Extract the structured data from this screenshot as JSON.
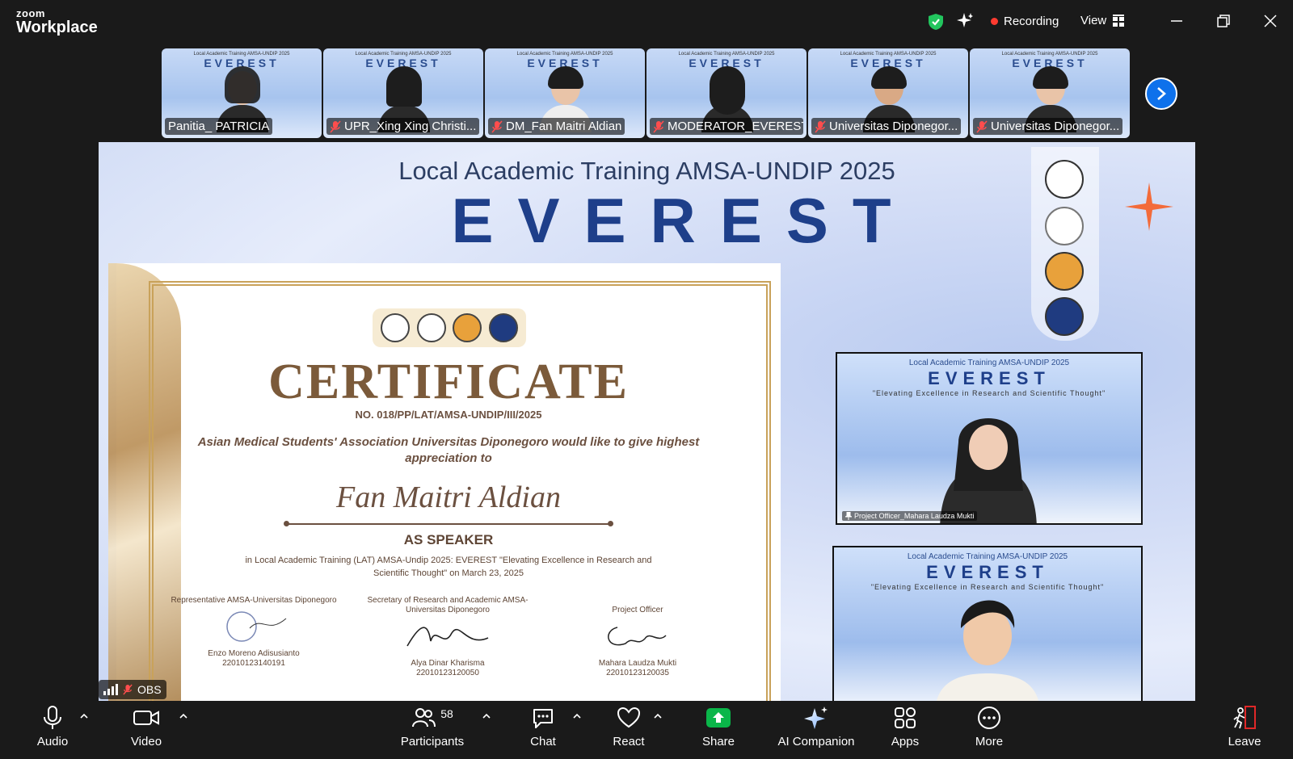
{
  "app": {
    "brand_small": "zoom",
    "brand_name": "Workplace"
  },
  "titlebar": {
    "recording_label": "Recording",
    "view_label": "View"
  },
  "participants_strip": [
    {
      "name": "Panitia_ PATRICIA",
      "muted": false
    },
    {
      "name": "UPR_Xing Xing Christi...",
      "muted": true
    },
    {
      "name": "DM_Fan Maitri Aldian",
      "muted": true
    },
    {
      "name": "MODERATOR_EVEREST",
      "muted": true
    },
    {
      "name": "Universitas Diponegor...",
      "muted": true
    },
    {
      "name": "Universitas Diponegor...",
      "muted": true
    }
  ],
  "thumb_banner": {
    "top": "Local Academic Training AMSA-UNDIP 2025",
    "big": "EVEREST",
    "sub": "\"Elevating Excellence in Research and Scientific Thought\""
  },
  "slide": {
    "title": "Local Academic Training AMSA-UNDIP 2025",
    "big": "EVEREST"
  },
  "certificate": {
    "title": "CERTIFICATE",
    "number": "NO. 018/PP/LAT/AMSA-UNDIP/III/2025",
    "give_text": "Asian Medical Students' Association Universitas Diponegoro would like to give highest appreciation to",
    "recipient": "Fan Maitri Aldian",
    "role": "AS SPEAKER",
    "description": "in Local Academic Training (LAT) AMSA-Undip 2025: EVEREST \"Elevating Excellence in Research and Scientific Thought\" on March 23, 2025",
    "signatories": [
      {
        "title": "Representative AMSA-Universitas Diponegoro",
        "name": "Enzo Moreno Adisusianto",
        "id": "22010123140191"
      },
      {
        "title": "Secretary of Research and Academic AMSA-Universitas Diponegoro",
        "name": "Alya Dinar Kharisma",
        "id": "22010123120050"
      },
      {
        "title": "Project Officer",
        "name": "Mahara Laudza Mukti",
        "id": "22010123120035"
      }
    ]
  },
  "presenter_videos": [
    {
      "top": "Local Academic Training AMSA-UNDIP 2025",
      "big": "EVEREST",
      "sub": "\"Elevating Excellence in Research and Scientific Thought\"",
      "label": "Project Officer_Mahara Laudza Mukti"
    },
    {
      "top": "Local Academic Training AMSA-UNDIP 2025",
      "big": "EVEREST",
      "sub": "\"Elevating Excellence in Research and Scientific Thought\"",
      "label": ""
    }
  ],
  "share_source": {
    "label": "OBS"
  },
  "toolbar": {
    "audio": "Audio",
    "video": "Video",
    "participants": "Participants",
    "participants_count": "58",
    "chat": "Chat",
    "react": "React",
    "share": "Share",
    "ai_companion": "AI Companion",
    "apps": "Apps",
    "more": "More",
    "leave": "Leave"
  },
  "colors": {
    "share_green": "#0ab649",
    "accent_blue": "#0e71eb",
    "recording_red": "#ff3b30",
    "leave_red": "#e02828"
  }
}
